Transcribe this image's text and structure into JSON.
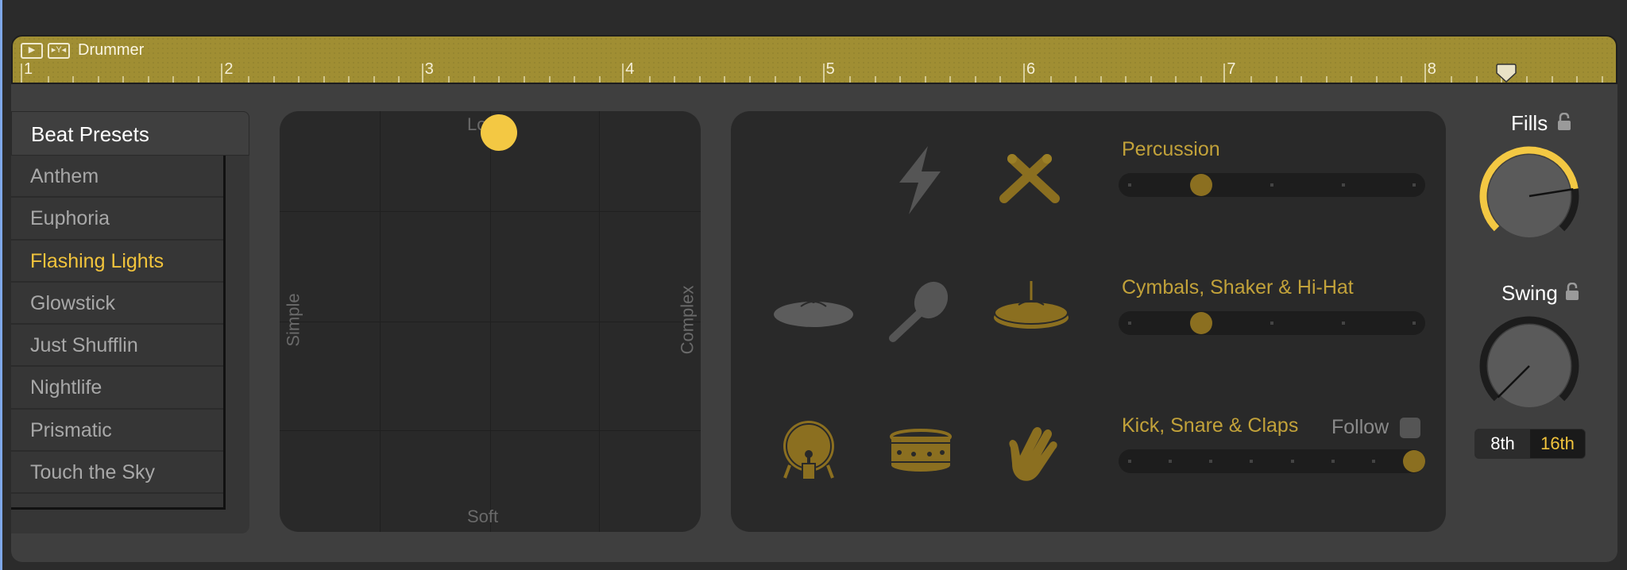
{
  "region": {
    "title": "Drummer",
    "color": "#a08e33",
    "bar_numbers": [
      "1",
      "2",
      "3",
      "4",
      "5",
      "6",
      "7",
      "8"
    ],
    "playhead_bar": 8.4
  },
  "presets": {
    "header": "Beat Presets",
    "items": [
      {
        "label": "Anthem",
        "selected": false
      },
      {
        "label": "Euphoria",
        "selected": false
      },
      {
        "label": "Flashing Lights",
        "selected": true
      },
      {
        "label": "Glowstick",
        "selected": false
      },
      {
        "label": "Just Shufflin",
        "selected": false
      },
      {
        "label": "Nightlife",
        "selected": false
      },
      {
        "label": "Prismatic",
        "selected": false
      },
      {
        "label": "Touch the Sky",
        "selected": false
      }
    ],
    "accent": "#f2c43c"
  },
  "xypad": {
    "top_label": "Loud",
    "bottom_label": "Soft",
    "left_label": "Simple",
    "right_label": "Complex",
    "puck_x": 0.52,
    "puck_y": 0.95
  },
  "instruments": {
    "icons": [
      {
        "name": "lightning-icon",
        "active": false
      },
      {
        "name": "drumsticks-icon",
        "active": true
      },
      {
        "name": "cymbal-icon",
        "active": false
      },
      {
        "name": "shaker-icon",
        "active": false
      },
      {
        "name": "hihat-icon",
        "active": true
      },
      {
        "name": "kick-drum-icon",
        "active": true
      },
      {
        "name": "snare-drum-icon",
        "active": true
      },
      {
        "name": "clap-hand-icon",
        "active": true
      }
    ],
    "sliders": [
      {
        "label": "Percussion",
        "detents": 5,
        "position": 1
      },
      {
        "label": "Cymbals, Shaker & Hi-Hat",
        "detents": 5,
        "position": 1
      },
      {
        "label": "Kick, Snare & Claps",
        "detents": 8,
        "position": 7
      }
    ],
    "follow_label": "Follow",
    "follow_checked": false
  },
  "fills": {
    "label": "Fills",
    "value": 0.8,
    "locked": false
  },
  "swing": {
    "label": "Swing",
    "value": 0.0,
    "locked": false
  },
  "resolution": {
    "options": [
      "8th",
      "16th"
    ],
    "selected": "16th"
  }
}
